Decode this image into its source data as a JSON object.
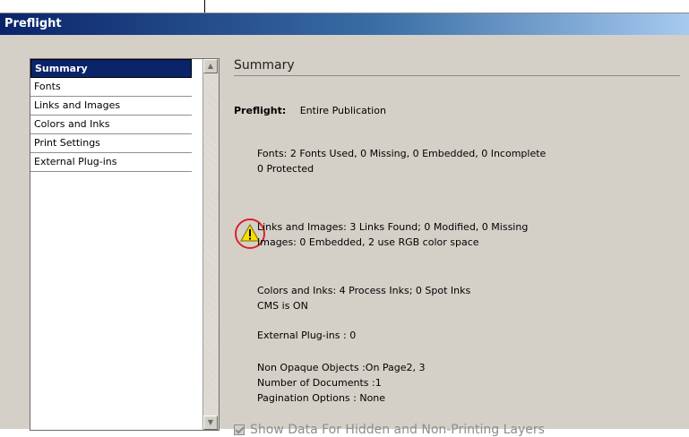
{
  "window": {
    "title": "Preflight"
  },
  "sidebar": {
    "items": [
      {
        "label": "Summary",
        "selected": true
      },
      {
        "label": "Fonts"
      },
      {
        "label": "Links and Images"
      },
      {
        "label": "Colors and Inks"
      },
      {
        "label": "Print Settings"
      },
      {
        "label": "External Plug-ins"
      }
    ]
  },
  "main": {
    "section_title": "Summary",
    "preflight_label": "Preflight:",
    "preflight_value": "Entire Publication",
    "fonts": [
      "Fonts: 2 Fonts Used, 0 Missing, 0 Embedded, 0 Incomplete",
      "0 Protected"
    ],
    "links": [
      "Links and Images: 3 Links Found; 0 Modified, 0 Missing",
      "Images: 0 Embedded, 2 use RGB color space"
    ],
    "colors": [
      "Colors and Inks: 4 Process Inks; 0 Spot Inks",
      "CMS is ON"
    ],
    "plugins": "External Plug-ins : 0",
    "misc": [
      "Non Opaque Objects :On Page2, 3",
      "Number of Documents :1",
      "Pagination Options : None"
    ],
    "checkbox_label": "Show Data For Hidden and Non-Printing Layers",
    "checkbox_checked": true
  },
  "colors": {
    "selection": "#0a246a",
    "warning_fill": "#f6e000",
    "warning_circle": "#d8232a",
    "background": "#d4d0c8"
  },
  "icons": [
    "warning-icon",
    "scroll-up-icon",
    "scroll-down-icon",
    "checkbox-check-icon"
  ]
}
